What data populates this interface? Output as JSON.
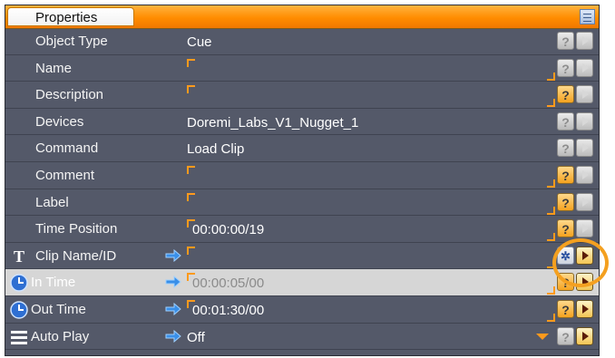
{
  "panel": {
    "title": "Properties",
    "header_button_icon": "list-view-icon"
  },
  "rows": [
    {
      "label": "Object Type",
      "value": "Cue",
      "help_state": "disabled",
      "play_state": "disabled"
    },
    {
      "label": "Name",
      "value": "",
      "help_state": "disabled",
      "play_state": "disabled"
    },
    {
      "label": "Description",
      "value": "",
      "help_state": "enabled",
      "play_state": "disabled"
    },
    {
      "label": "Devices",
      "value": "Doremi_Labs_V1_Nugget_1",
      "help_state": "disabled",
      "play_state": "disabled"
    },
    {
      "label": "Command",
      "value": "Load Clip",
      "help_state": "disabled",
      "play_state": "disabled"
    },
    {
      "label": "Comment",
      "value": "",
      "help_state": "enabled",
      "play_state": "disabled"
    },
    {
      "label": "Label",
      "value": "",
      "help_state": "enabled",
      "play_state": "disabled"
    },
    {
      "label": "Time Position",
      "value": "00:00:00/19",
      "help_state": "enabled",
      "play_state": "disabled"
    },
    {
      "label": "Clip Name/ID",
      "value": "",
      "icon": "text-icon",
      "help_state": "wand",
      "play_state": "enabled"
    },
    {
      "label": "In Time",
      "value": "00:00:05/00",
      "icon": "clock-icon",
      "help_state": "enabled",
      "play_state": "enabled",
      "highlighted": true
    },
    {
      "label": "Out Time",
      "value": "00:01:30/00",
      "icon": "clock-icon",
      "help_state": "enabled",
      "play_state": "enabled"
    },
    {
      "label": "Auto Play",
      "value": "Off",
      "icon": "menu-icon",
      "help_state": "disabled",
      "play_state": "enabled",
      "dropdown": true
    }
  ],
  "colors": {
    "header_orange": "#ff8c00",
    "panel_bg": "#545969",
    "highlight_row": "#d6d6d6",
    "field_corner": "#ff9a1c",
    "annotation_circle": "#f4a020"
  },
  "icons": [
    "list-view-icon",
    "text-icon",
    "clock-icon",
    "menu-icon",
    "link-arrow-icon",
    "help-icon",
    "magic-wand-icon",
    "play-icon",
    "dropdown-icon"
  ]
}
